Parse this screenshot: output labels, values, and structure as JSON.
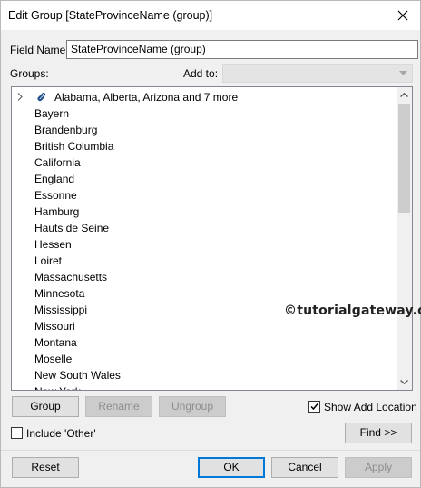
{
  "dialog": {
    "title": "Edit Group [StateProvinceName (group)]",
    "close_icon": "close-icon"
  },
  "field_name": {
    "label": "Field Name:",
    "value": "StateProvinceName (group)"
  },
  "groups_label": "Groups:",
  "add_to": {
    "label": "Add to:",
    "value": ""
  },
  "group_list": {
    "group_item": {
      "label": "Alabama, Alberta, Arizona and 7 more",
      "icon": "paperclip-icon",
      "expander_icon": "chevron-right-icon"
    },
    "items": [
      "Bayern",
      "Brandenburg",
      "British Columbia",
      "California",
      "England",
      "Essonne",
      "Hamburg",
      "Hauts de Seine",
      "Hessen",
      "Loiret",
      "Massachusetts",
      "Minnesota",
      "Mississippi",
      "Missouri",
      "Montana",
      "Moselle",
      "New South Wales",
      "New York"
    ]
  },
  "buttons": {
    "group": "Group",
    "rename": "Rename",
    "ungroup": "Ungroup",
    "find": "Find >>",
    "reset": "Reset",
    "ok": "OK",
    "cancel": "Cancel",
    "apply": "Apply"
  },
  "checkboxes": {
    "show_add_location": {
      "label": "Show Add Location",
      "checked": true
    },
    "include_other": {
      "label": "Include 'Other'",
      "checked": false
    }
  },
  "watermark": "©tutorialgateway.org",
  "colors": {
    "accent": "#0078d7",
    "window_bg": "#f0f0f0",
    "disabled_text": "#8d8d8d"
  }
}
